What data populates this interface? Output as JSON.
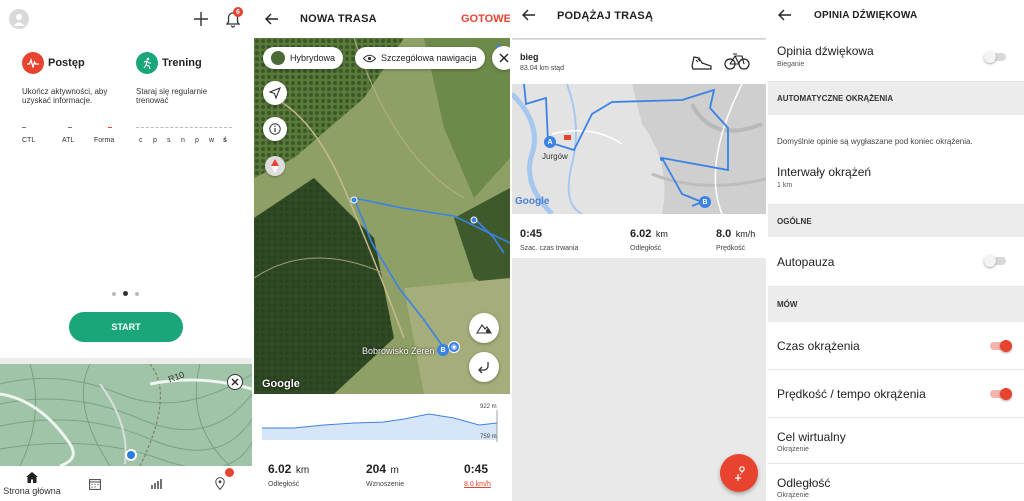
{
  "p1": {
    "badge_count": "6",
    "cards": [
      {
        "title": "Postęp",
        "desc": "Ukończ aktywności, aby uzyskać informacje.",
        "labels": [
          "CTL",
          "ATL",
          "Forma"
        ]
      },
      {
        "title": "Trening",
        "desc": "Staraj się regularnie trenować",
        "labels": [
          "c",
          "p",
          "s",
          "n",
          "p",
          "w",
          "ś"
        ]
      }
    ],
    "start_label": "START",
    "tabs": [
      {
        "label": "Strona główna"
      },
      {
        "label": ""
      },
      {
        "label": ""
      },
      {
        "label": ""
      }
    ],
    "map_label": "R10"
  },
  "p2": {
    "title": "NOWA TRASA",
    "done": "GOTOWE",
    "pill_hybrid": "Hybrydowa",
    "pill_nav": "Szczegółowa nawigacja",
    "place": "Bobrowisko Zeren",
    "google": "Google",
    "elev_max": "922 m",
    "elev_min": "759 m",
    "stats": [
      {
        "value": "6.02",
        "unit": "km",
        "label": "Odległość"
      },
      {
        "value": "204",
        "unit": "m",
        "label": "Wznoszenie"
      },
      {
        "value": "0:45",
        "unit": "",
        "label": "8.0 km/h"
      }
    ]
  },
  "p3": {
    "title": "PODĄŻAJ TRASĄ",
    "route_name": "bieg",
    "route_dist": "83.04 km stąd",
    "town": "Jurgów",
    "google": "Google",
    "stats": [
      {
        "value": "0:45",
        "unit": "",
        "label": "Szac. czas trwania"
      },
      {
        "value": "6.02",
        "unit": "km",
        "label": "Odległość"
      },
      {
        "value": "8.0",
        "unit": "km/h",
        "label": "Prędkość"
      }
    ]
  },
  "p4": {
    "title": "OPINIA DŹWIĘKOWA",
    "rows": {
      "opinia": {
        "title": "Opinia dźwiękowa",
        "sub": "Bieganie"
      },
      "sec_auto": "AUTOMATYCZNE OKRĄŻENIA",
      "info": "Domyślnie opinie są wygłaszane pod koniec okrążenia.",
      "interwaly": {
        "title": "Interwały okrążeń",
        "sub": "1 km"
      },
      "sec_ogolne": "OGÓLNE",
      "autopauza": {
        "title": "Autopauza"
      },
      "sec_mow": "MÓW",
      "czas": {
        "title": "Czas okrążenia"
      },
      "predkosc": {
        "title": "Prędkość / tempo okrążenia"
      },
      "cel": {
        "title": "Cel wirtualny",
        "sub": "Okrążenie"
      },
      "odleglosc": {
        "title": "Odległość",
        "sub": "Okrążenie"
      }
    }
  },
  "colors": {
    "accent": "#e8432f",
    "green": "#1aa67a",
    "route": "#3b82e6"
  }
}
